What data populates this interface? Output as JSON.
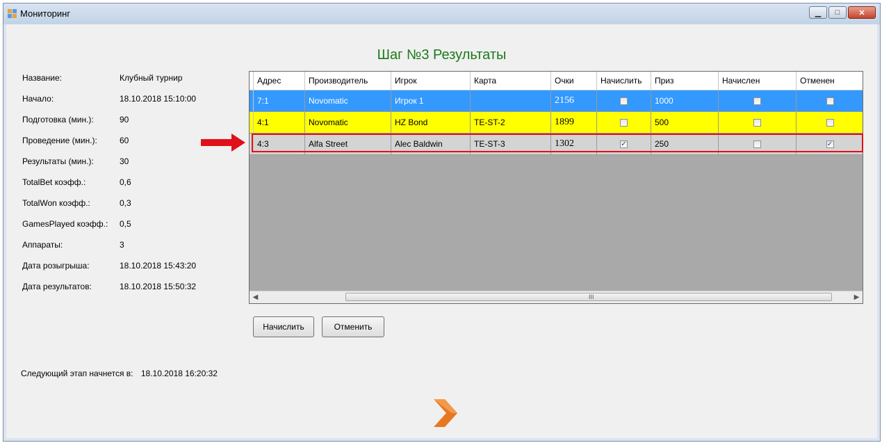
{
  "window": {
    "title": "Мониторинг"
  },
  "heading": "Шаг №3 Результаты",
  "info": [
    {
      "label": "Название:",
      "value": "Клубный турнир"
    },
    {
      "label": "Начало:",
      "value": "18.10.2018 15:10:00"
    },
    {
      "label": "Подготовка (мин.):",
      "value": "90"
    },
    {
      "label": "Проведение (мин.):",
      "value": "60"
    },
    {
      "label": "Результаты (мин.):",
      "value": "30"
    },
    {
      "label": "TotalBet коэфф.:",
      "value": "0,6"
    },
    {
      "label": "TotalWon коэфф.:",
      "value": "0,3"
    },
    {
      "label": "GamesPlayed коэфф.:",
      "value": "0,5"
    },
    {
      "label": "Аппараты:",
      "value": "3"
    },
    {
      "label": "Дата розыгрыша:",
      "value": "18.10.2018 15:43:20"
    },
    {
      "label": "Дата результатов:",
      "value": "18.10.2018 15:50:32"
    }
  ],
  "grid": {
    "columns": [
      "Адрес",
      "Производитель",
      "Игрок",
      "Карта",
      "Очки",
      "Начислить",
      "Приз",
      "Начислен",
      "Отменен"
    ],
    "rows": [
      {
        "address": "7:1",
        "maker": "Novomatic",
        "player": "Игрок 1",
        "card": "",
        "points": "2156",
        "accrue": false,
        "prize": "1000",
        "accrued": false,
        "canceled": false,
        "bg": "#3399ff",
        "fg": "#ffffff"
      },
      {
        "address": "4:1",
        "maker": "Novomatic",
        "player": "HZ Bond",
        "card": "TE-ST-2",
        "points": "1899",
        "accrue": false,
        "prize": "500",
        "accrued": false,
        "canceled": false,
        "bg": "#ffff00",
        "fg": "#000000"
      },
      {
        "address": "4:3",
        "maker": "Alfa Street",
        "player": "Alec Baldwin",
        "card": "TE-ST-3",
        "points": "1302",
        "accrue": true,
        "prize": "250",
        "accrued": false,
        "canceled": true,
        "bg": "#d4d4d4",
        "fg": "#000000"
      }
    ],
    "scroll_grip": "III"
  },
  "buttons": {
    "accrue": "Начислить",
    "cancel": "Отменить"
  },
  "next_stage": {
    "label": "Следующий этап начнется в:",
    "value": "18.10.2018 16:20:32"
  },
  "colors": {
    "heading": "#1a7a1a",
    "highlight_arrow": "#e0101a",
    "next_arrow": "#e87722"
  }
}
